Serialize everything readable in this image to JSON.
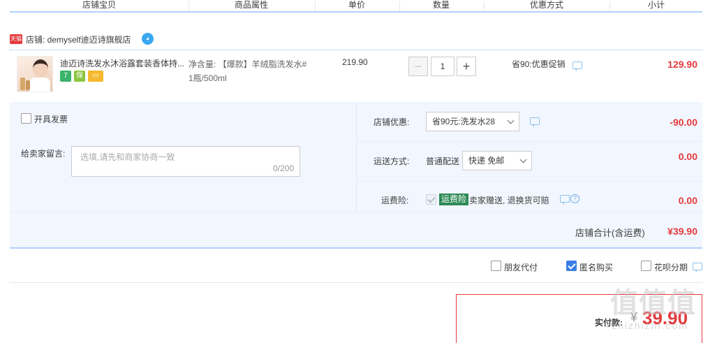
{
  "columns": [
    "店铺宝贝",
    "商品属性",
    "单价",
    "数量",
    "优惠方式",
    "小计"
  ],
  "shop": {
    "badge": "天猫",
    "label": "店铺: demyself迪迈诗旗舰店",
    "chat_icon": "wangwang-icon"
  },
  "item": {
    "title": "迪迈诗洗发水沐浴露套装香体持...",
    "sku_line1": "净含量: 【爆款】羊绒脂洗发水#",
    "sku_line2": "1瓶/500ml",
    "unit_price": "219.90",
    "quantity": "1",
    "minus_label": "−",
    "plus_label": "+",
    "promo": "省90:优惠促销",
    "subtotal": "129.90",
    "service_icons": [
      {
        "name": "7-day-return-icon",
        "text": "7",
        "color": "#3bb36b"
      },
      {
        "name": "guarantee-icon",
        "text": "保",
        "color": "#8cc63f"
      },
      {
        "name": "credit-card-icon",
        "text": "▭",
        "color": "#f5b82e"
      }
    ]
  },
  "invoice": {
    "label": "开具发票",
    "checked": false
  },
  "message": {
    "label": "给卖家留言:",
    "placeholder": "选填,请先和商家协商一致",
    "count": "0/200"
  },
  "shop_discount": {
    "label": "店铺优惠:",
    "selected": "省90元:洗发水28",
    "amount": "-90.00"
  },
  "shipping": {
    "label": "运送方式:",
    "method": "普通配送",
    "selected": "快递 免邮",
    "amount": "0.00"
  },
  "insurance": {
    "label": "运费险:",
    "badge": "运费险",
    "desc": "卖家赠送, 退换货可赔",
    "amount": "0.00"
  },
  "shop_total": {
    "label": "店铺合计(含运费)",
    "value": "¥39.90"
  },
  "options": [
    {
      "label": "朋友代付",
      "checked": false
    },
    {
      "label": "匿名购买",
      "checked": true
    },
    {
      "label": "花呗分期",
      "checked": false
    }
  ],
  "payment": {
    "label": "实付款:",
    "currency": "¥",
    "value": "39.90"
  },
  "watermark": {
    "text": "值值值",
    "sub": "zhizhizhi.com"
  }
}
